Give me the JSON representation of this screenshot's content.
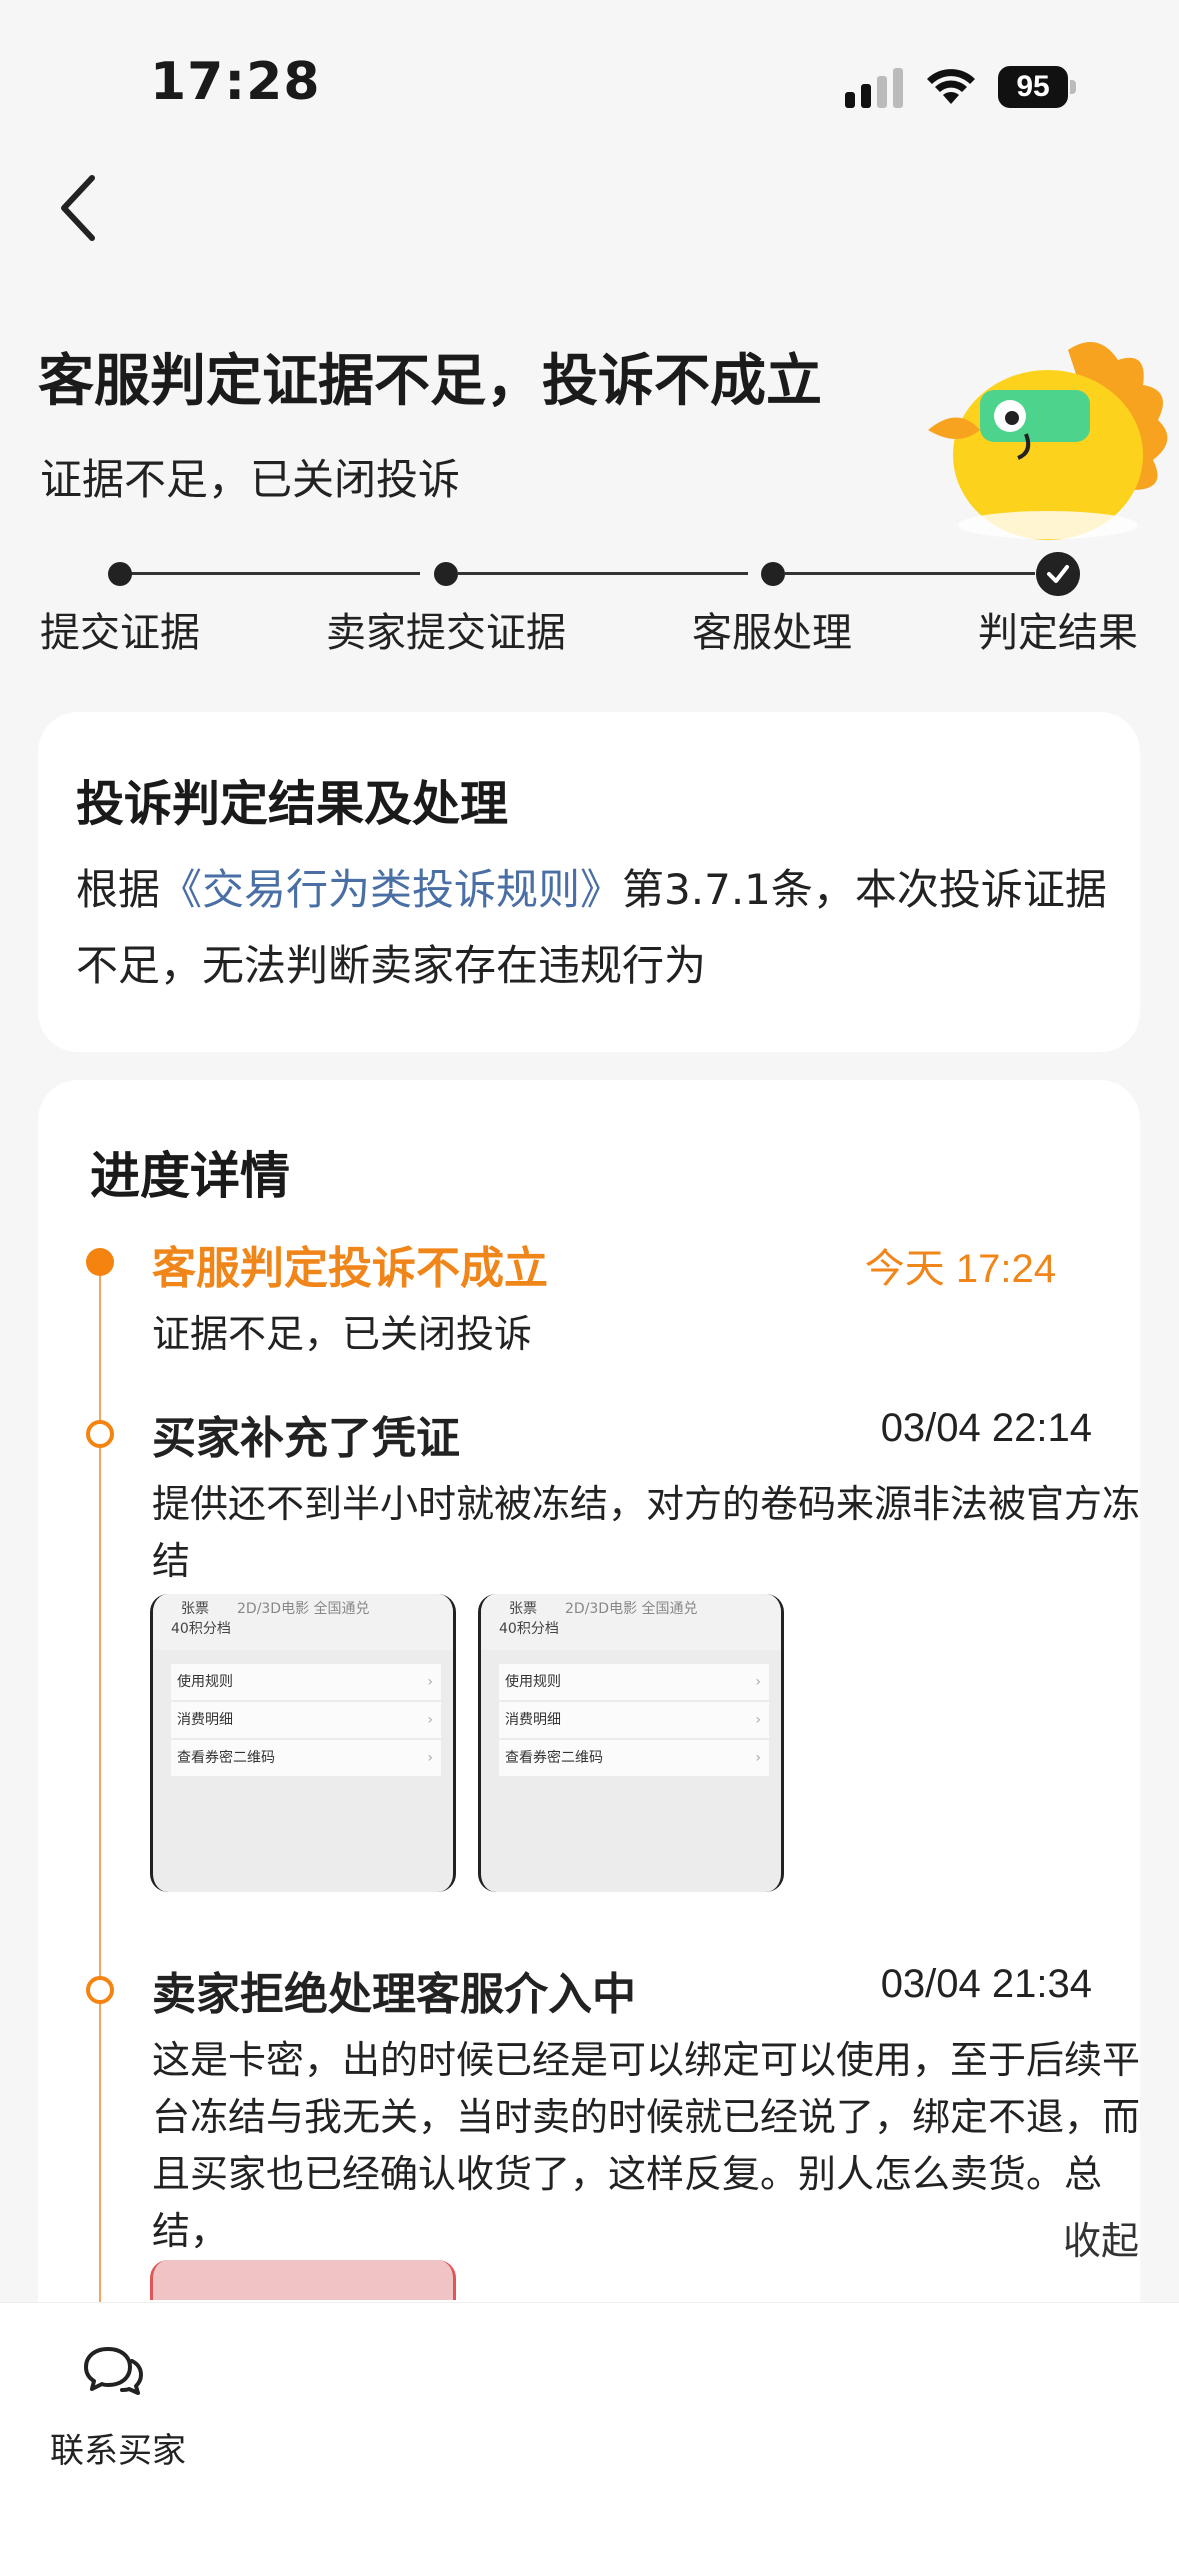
{
  "status_bar": {
    "time": "17:28",
    "battery": "95"
  },
  "header": {
    "title": "客服判定证据不足，投诉不成立",
    "subtitle": "证据不足，已关闭投诉"
  },
  "steps": [
    "提交证据",
    "卖家提交证据",
    "客服处理",
    "判定结果"
  ],
  "result_card": {
    "title": "投诉判定结果及处理",
    "body_prefix": "根据",
    "rule_link": "《交易行为类投诉规则》",
    "body_suffix": "第3.7.1条，本次投诉证据不足，无法判断卖家存在违规行为"
  },
  "progress": {
    "title": "进度详情",
    "events": [
      {
        "title": "客服判定投诉不成立",
        "time": "今天 17:24",
        "text": "证据不足，已关闭投诉"
      },
      {
        "title": "买家补充了凭证",
        "time": "03/04 22:14",
        "text": "提供还不到半小时就被冻结，对方的卷码来源非法被官方冻结"
      },
      {
        "title": "卖家拒绝处理客服介入中",
        "time": "03/04 21:34",
        "text": "这是卡密，出的时候已经是可以绑定可以使用，至于后续平台冻结与我无关，当时卖的时候就已经说了，绑定不退，而且买家也已经确认收货了，这样反复。别人怎么卖货。总结，"
      }
    ],
    "collapse": "收起",
    "thumbnails": [
      {
        "name": "张票",
        "points": "40积分档",
        "sub": "2D/3D电影 全国通兑",
        "rows": [
          "使用规则",
          "消费明细",
          "查看券密二维码"
        ]
      },
      {
        "name": "张票",
        "points": "40积分档",
        "sub": "2D/3D电影 全国通兑",
        "rows": [
          "使用规则",
          "消费明细",
          "查看券密二维码"
        ]
      }
    ]
  },
  "bottom": {
    "contact_label": "联系买家"
  },
  "colors": {
    "accent": "#f5830f",
    "link": "#4a6fa5"
  }
}
